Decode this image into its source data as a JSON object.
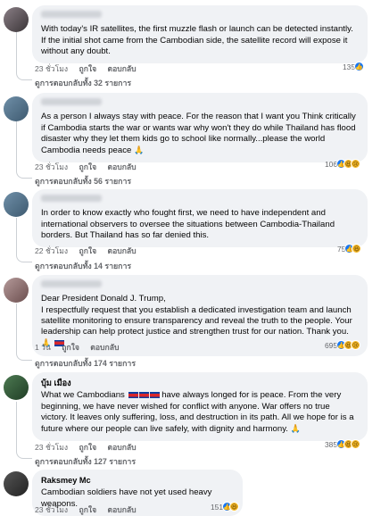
{
  "comments": [
    {
      "author": "",
      "text": "With today's IR satellites, the first muzzle flash or launch can be detected instantly. If the initial shot came from the Cambodian side, the satellite record will expose it without any doubt.",
      "time": "23 ชั่วโมง",
      "like": "ถูกใจ",
      "reply": "ตอบกลับ",
      "reaction_count": "135",
      "reactions": [
        "like-icon"
      ],
      "replies": "ดูการตอบกลับทั้ง 32 รายการ"
    },
    {
      "author": "",
      "text": "As a person I always stay with peace. For the reason that I want you Think critically if Cambodia starts the war or wants war why won't they do while Thailand has flood disaster why they let them kids go to school like normally...please the world Cambodia needs peace",
      "time": "23 ชั่วโมง",
      "like": "ถูกใจ",
      "reply": "ตอบกลับ",
      "reaction_count": "106",
      "reactions": [
        "like-icon",
        "haha-icon",
        "sad-icon"
      ],
      "replies": "ดูการตอบกลับทั้ง 56 รายการ"
    },
    {
      "author": "",
      "text": "In order to know exactly who fought first, we need to have independent and international observers to oversee the situations between Cambodia-Thailand borders. But Thailand has so far denied this.",
      "time": "22 ชั่วโมง",
      "like": "ถูกใจ",
      "reply": "ตอบกลับ",
      "reaction_count": "75",
      "reactions": [
        "like-icon",
        "haha-icon"
      ],
      "replies": "ดูการตอบกลับทั้ง 14 รายการ"
    },
    {
      "author": "",
      "text_line1": "Dear President Donald J. Trump,",
      "text": "I respectfully request that you establish a dedicated investigation team and launch satellite monitoring to ensure transparency and reveal the truth to the people. Your leadership can help protect justice and strengthen trust for our nation. Thank you.",
      "time": "1 วัน",
      "like": "ถูกใจ",
      "reply": "ตอบกลับ",
      "reaction_count": "695",
      "reactions": [
        "like-icon",
        "haha-icon",
        "sad-icon"
      ],
      "replies": "ดูการตอบกลับทั้ง 174 รายการ"
    },
    {
      "author": "บุ้ม เมือง",
      "text_a": "What we Cambodians",
      "text": "have always longed for is peace. From the very beginning, we have never wished for conflict with anyone. War offers no true victory. It leaves only suffering, loss, and destruction in its path. All we hope for is a future where our people can live safely, with dignity and harmony.",
      "time": "23 ชั่วโมง",
      "like": "ถูกใจ",
      "reply": "ตอบกลับ",
      "reaction_count": "385",
      "reactions": [
        "like-icon",
        "haha-icon",
        "sad-icon"
      ],
      "replies": "ดูการตอบกลับทั้ง 127 รายการ"
    },
    {
      "author": "Raksmey Mc",
      "text": "Cambodian soldiers have not yet used heavy weapons.",
      "time": "23 ชั่วโมง",
      "like": "ถูกใจ",
      "reply": "ตอบกลับ",
      "reaction_count": "151",
      "reactions": [
        "like-icon",
        "haha-icon"
      ]
    }
  ],
  "colors": {
    "bubble": "#f0f2f5",
    "meta_text": "#65676b",
    "like": "#1877f2",
    "emoji": "#f7b928"
  }
}
